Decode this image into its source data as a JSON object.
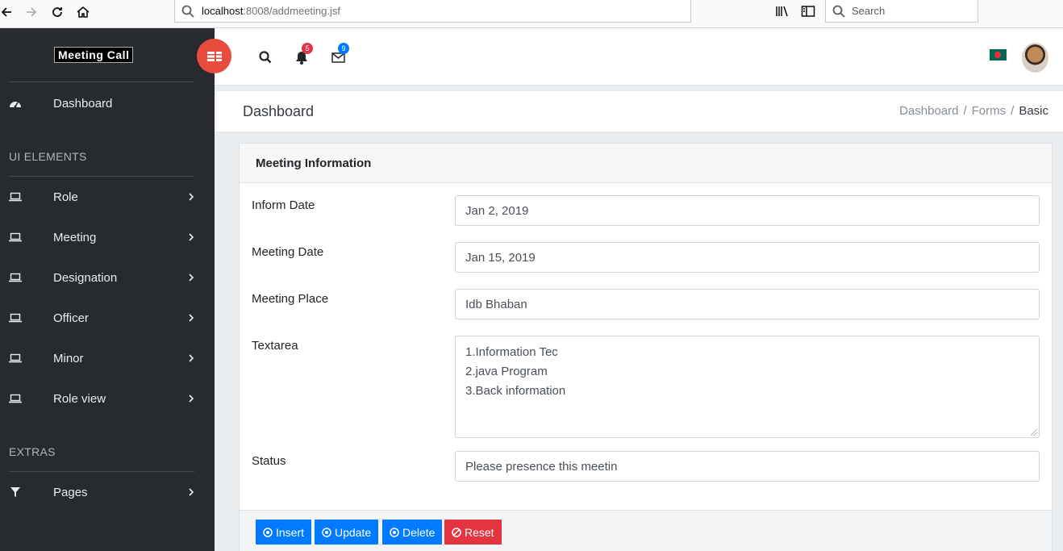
{
  "browser": {
    "url_host": "localhost",
    "url_path": ":8008/addmeeting.jsf",
    "search_placeholder": "Search"
  },
  "sidebar": {
    "logo": "Meeting Call",
    "dashboard_label": "Dashboard",
    "section_ui": "UI ELEMENTS",
    "items": [
      {
        "label": "Role",
        "icon": "laptop-icon"
      },
      {
        "label": "Meeting",
        "icon": "laptop-icon"
      },
      {
        "label": "Designation",
        "icon": "laptop-icon"
      },
      {
        "label": "Officer",
        "icon": "laptop-icon"
      },
      {
        "label": "Minor",
        "icon": "laptop-icon"
      },
      {
        "label": "Role view",
        "icon": "laptop-icon"
      }
    ],
    "section_extras": "EXTRAS",
    "pages_label": "Pages"
  },
  "topbar": {
    "notifications_count": "5",
    "messages_count": "9",
    "colors": {
      "toggle": "#e74c3c",
      "notif_badge": "#dc3545",
      "msg_badge": "#007bff"
    }
  },
  "page": {
    "title": "Dashboard",
    "breadcrumb": [
      "Dashboard",
      "Forms",
      "Basic"
    ]
  },
  "form": {
    "header": "Meeting Information",
    "inform_date_label": "Inform Date",
    "inform_date_value": "Jan 2, 2019",
    "meeting_date_label": "Meeting Date",
    "meeting_date_value": "Jan 15, 2019",
    "meeting_place_label": "Meeting Place",
    "meeting_place_value": "Idb Bhaban",
    "textarea_label": "Textarea",
    "textarea_lines": [
      "1.Information Tec",
      "2.java Program",
      "3.Back information"
    ],
    "status_label": "Status",
    "status_value": "Please presence this meetin"
  },
  "buttons": {
    "insert": "Insert",
    "update": "Update",
    "delete": "Delete",
    "reset": "Reset"
  }
}
